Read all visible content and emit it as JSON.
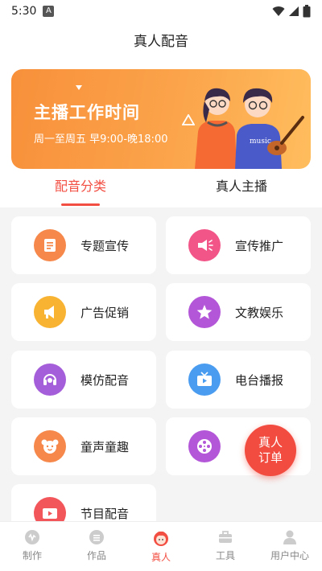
{
  "status_bar": {
    "time": "5:30",
    "badge": "A"
  },
  "header": {
    "title": "真人配音"
  },
  "banner": {
    "title": "主播工作时间",
    "subtitle": "周一至周五 早9:00-晚18:00",
    "shirt_text": "music"
  },
  "tabs": [
    {
      "label": "配音分类",
      "active": true
    },
    {
      "label": "真人主播",
      "active": false
    }
  ],
  "categories": [
    {
      "label": "专题宣传",
      "icon": "document-icon",
      "color": "#f5884a"
    },
    {
      "label": "宣传推广",
      "icon": "megaphone-icon",
      "color": "#f25588"
    },
    {
      "label": "广告促销",
      "icon": "loudspeaker-icon",
      "color": "#f8b332"
    },
    {
      "label": "文教娱乐",
      "icon": "star-icon",
      "color": "#b357d8"
    },
    {
      "label": "模仿配音",
      "icon": "headset-icon",
      "color": "#a55ed9"
    },
    {
      "label": "电台播报",
      "icon": "tv-icon",
      "color": "#4a9cf0"
    },
    {
      "label": "童声童趣",
      "icon": "bear-icon",
      "color": "#f5884a"
    },
    {
      "label": "",
      "icon": "film-reel-icon",
      "color": "#b357d8"
    },
    {
      "label": "节目配音",
      "icon": "video-icon",
      "color": "#f2565a"
    }
  ],
  "fab": {
    "line1": "真人",
    "line2": "订单"
  },
  "nav": [
    {
      "label": "制作",
      "icon": "make-icon",
      "active": false
    },
    {
      "label": "作品",
      "icon": "works-icon",
      "active": false
    },
    {
      "label": "真人",
      "icon": "person-icon",
      "active": true
    },
    {
      "label": "工具",
      "icon": "toolbox-icon",
      "active": false
    },
    {
      "label": "用户中心",
      "icon": "user-icon",
      "active": false
    }
  ],
  "colors": {
    "accent": "#f24e42",
    "banner_start": "#f8903a",
    "banner_end": "#ffbd5e"
  }
}
